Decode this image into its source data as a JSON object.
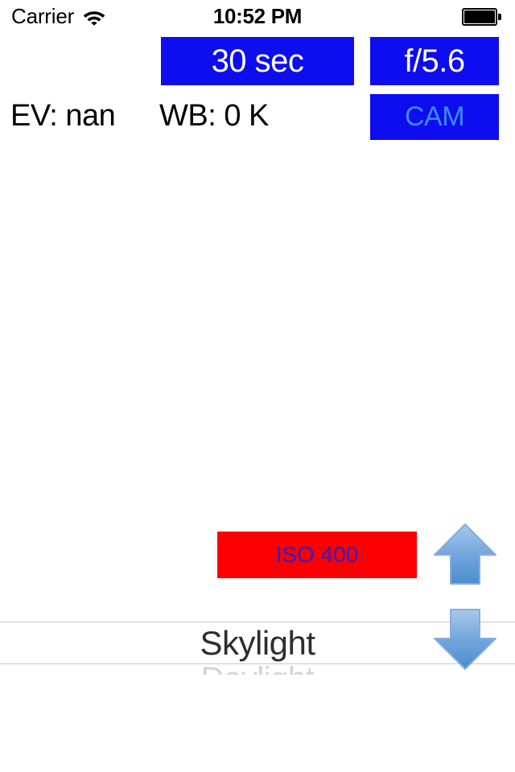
{
  "status_bar": {
    "carrier": "Carrier",
    "wifi_icon": "wifi-icon",
    "time": "10:52 PM",
    "battery_icon": "battery-full-icon"
  },
  "controls": {
    "shutter_speed": "30 sec",
    "aperture": "f/5.6",
    "camera_label": "CAM",
    "ev_readout": "EV: nan",
    "wb_readout": "WB: 0 K",
    "iso_label": "ISO 400"
  },
  "picker": {
    "selected": "Skylight",
    "next_partial": "Daylight"
  },
  "steppers": {
    "up_icon": "arrow-up-icon",
    "down_icon": "arrow-down-icon"
  },
  "colors": {
    "button_blue": "#0d0df0",
    "iso_red": "#fb0000",
    "iso_text": "#2b20cf",
    "cam_text": "#3a8ef5",
    "arrow_blue": "#5b9bd5",
    "picker_line": "#c8c8cc"
  }
}
